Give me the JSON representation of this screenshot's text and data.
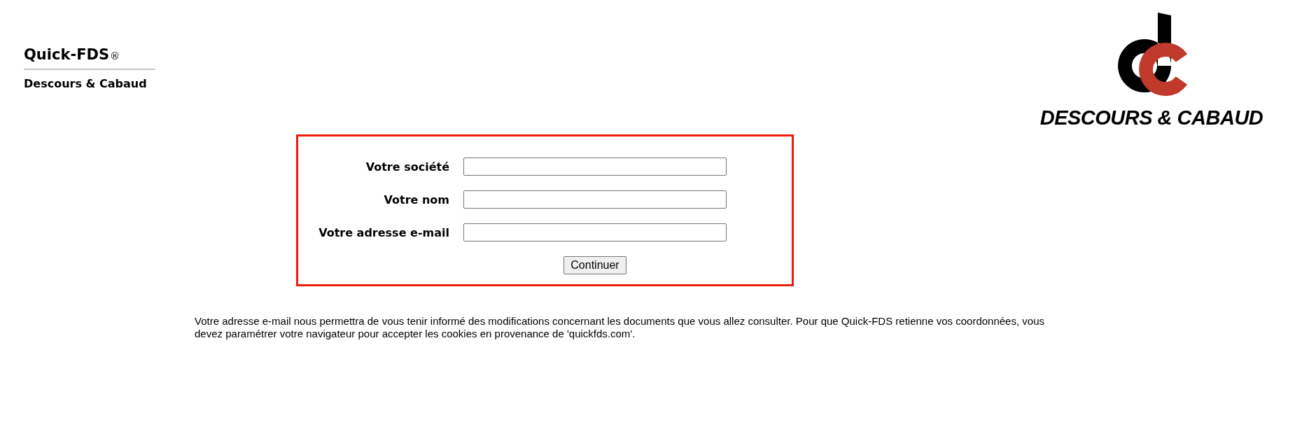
{
  "brand": {
    "name": "Quick-FDS",
    "mark": "®",
    "company": "Descours & Cabaud"
  },
  "logo": {
    "text": "DESCOURS & CABAUD"
  },
  "form": {
    "fields": [
      {
        "label": "Votre société"
      },
      {
        "label": "Votre nom"
      },
      {
        "label": "Votre adresse e-mail"
      }
    ],
    "button": "Continuer"
  },
  "notice": "Votre adresse e-mail nous permettra de vous tenir informé des modifications concernant les documents que vous allez consulter. Pour que Quick-FDS retienne vos coordonnées, vous devez paramétrer votre navigateur pour accepter les cookies en provenance de 'quickfds.com'."
}
